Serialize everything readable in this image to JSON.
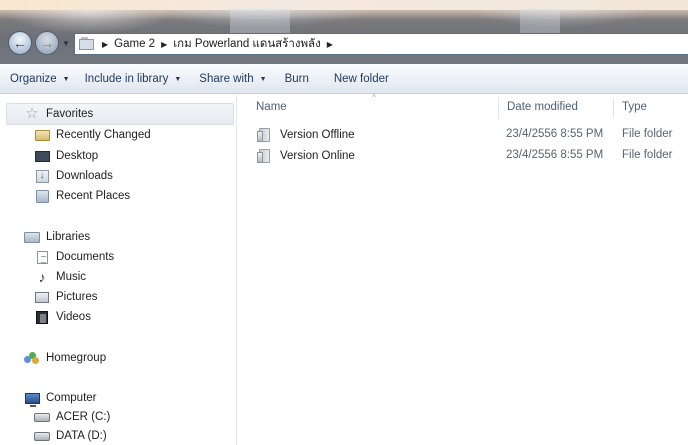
{
  "address_bar": {
    "breadcrumbs": [
      "Game 2",
      "เกม Powerland แดนสร้างพลัง"
    ]
  },
  "command_bar": {
    "organize": "Organize",
    "include_in_library": "Include in library",
    "share_with": "Share with",
    "burn": "Burn",
    "new_folder": "New folder"
  },
  "navigation": {
    "favorites": {
      "label": "Favorites",
      "items": [
        "Recently Changed",
        "Desktop",
        "Downloads",
        "Recent Places"
      ]
    },
    "libraries": {
      "label": "Libraries",
      "items": [
        "Documents",
        "Music",
        "Pictures",
        "Videos"
      ]
    },
    "homegroup": "Homegroup",
    "computer": {
      "label": "Computer",
      "items": [
        "ACER (C:)",
        "DATA (D:)"
      ]
    }
  },
  "file_list": {
    "columns": {
      "name": "Name",
      "date_modified": "Date modified",
      "type": "Type"
    },
    "rows": [
      {
        "name": "Version Offline",
        "date_modified": "23/4/2556 8:55 PM",
        "type": "File folder"
      },
      {
        "name": "Version Online",
        "date_modified": "23/4/2556 8:55 PM",
        "type": "File folder"
      }
    ]
  },
  "icons": {
    "back": "back-arrow-icon",
    "forward": "forward-arrow-icon",
    "address": "folder-location-icon",
    "favorites": "star-icon",
    "folder": "folder-icon"
  },
  "colors": {
    "command_text": "#1e395b",
    "column_header_text": "#4c607a",
    "detail_text": "#5a6270"
  }
}
